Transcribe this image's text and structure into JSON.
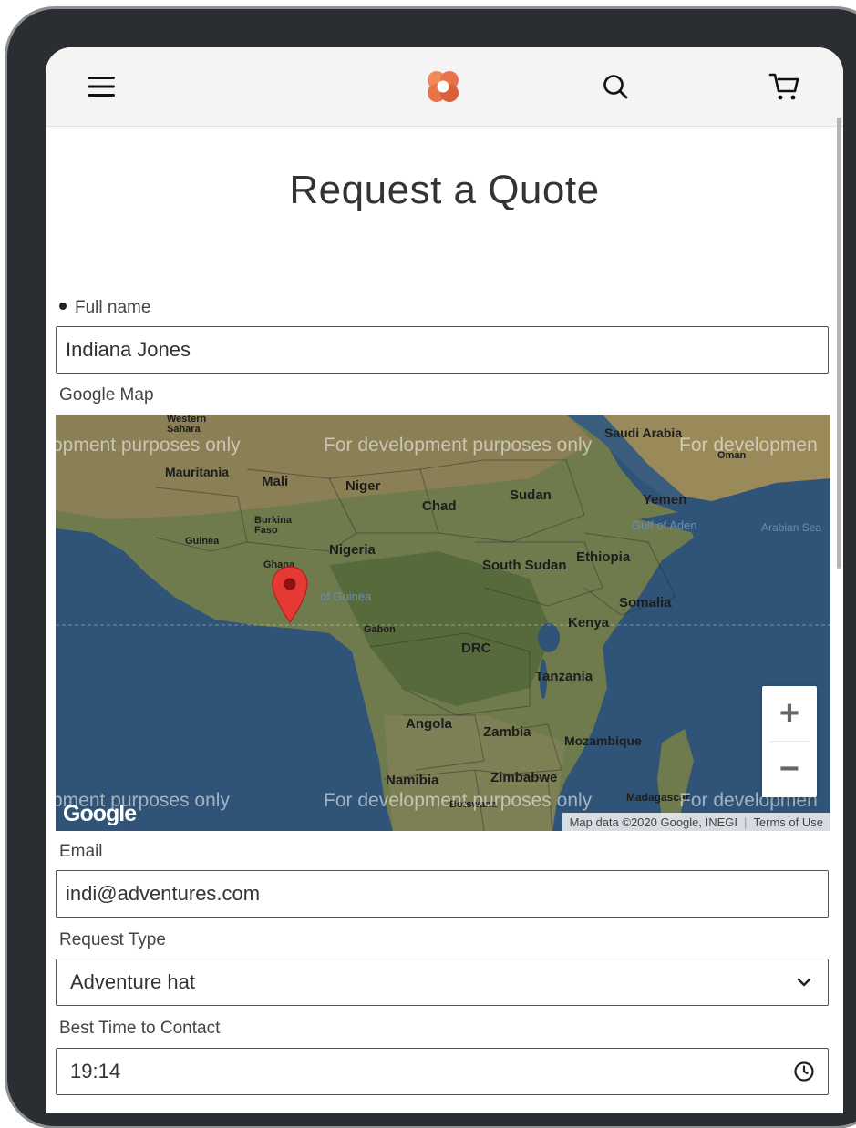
{
  "header": {
    "menu_icon": "hamburger-menu-icon",
    "logo_icon": "brand-logo-icon",
    "search_icon": "search-icon",
    "cart_icon": "shopping-cart-icon",
    "brand_color": "#e8734a"
  },
  "page": {
    "title": "Request a Quote"
  },
  "form": {
    "full_name": {
      "label": "Full name",
      "value": "Indiana Jones"
    },
    "map": {
      "label": "Google Map",
      "labels": {
        "western_sahara_1": "Western",
        "western_sahara_2": "Sahara",
        "mauritania": "Mauritania",
        "mali": "Mali",
        "niger": "Niger",
        "chad": "Chad",
        "sudan": "Sudan",
        "saudi_arabia": "Saudi Arabia",
        "oman": "Oman",
        "yemen": "Yemen",
        "gulf_of_aden": "Gulf of Aden",
        "arabian_sea": "Arabian Sea",
        "burkina_1": "Burkina",
        "burkina_2": "Faso",
        "guinea": "Guinea",
        "nigeria": "Nigeria",
        "ghana": "Ghana",
        "gulf_of_guinea": "of Guinea",
        "south_sudan": "South Sudan",
        "ethiopia": "Ethiopia",
        "somalia": "Somalia",
        "kenya": "Kenya",
        "gabon": "Gabon",
        "drc": "DRC",
        "tanzania": "Tanzania",
        "angola": "Angola",
        "zambia": "Zambia",
        "mozambique": "Mozambique",
        "namibia": "Namibia",
        "zimbabwe": "Zimbabwe",
        "botswana": "Botswana",
        "madagascar": "Madagascar"
      },
      "watermark_1": "opment purposes only",
      "watermark_2": "For development purposes only",
      "watermark_3": "For developmen",
      "watermark_4": "pment purposes only",
      "watermark_5": "For development purposes only",
      "watermark_6": "For developmen",
      "zoom_in": "+",
      "zoom_out": "−",
      "google_logo": "Google",
      "attribution": "Map data ©2020 Google, INEGI",
      "terms": "Terms of Use",
      "marker_color": "#e53935",
      "ocean_color": "#2f5478"
    },
    "email": {
      "label": "Email",
      "value": "indi@adventures.com"
    },
    "request_type": {
      "label": "Request Type",
      "value": "Adventure hat"
    },
    "best_time": {
      "label": "Best Time to Contact",
      "value": "19:14"
    }
  }
}
